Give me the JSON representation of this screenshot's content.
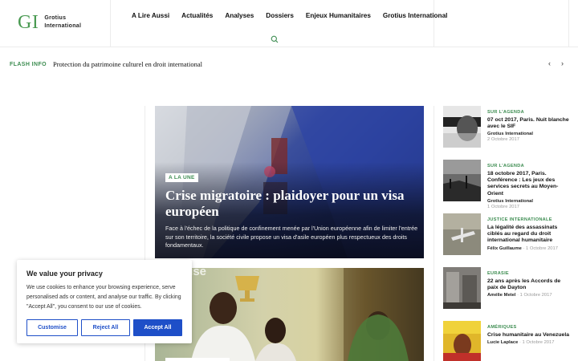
{
  "header": {
    "logo_mark": "GI",
    "logo_line1": "Grotius",
    "logo_line2": "International",
    "nav": [
      "A Lire Aussi",
      "Actualités",
      "Analyses",
      "Dossiers",
      "Enjeux Humanitaires",
      "Grotius International"
    ]
  },
  "flash": {
    "label": "FLASH INFO",
    "text": "Protection du patrimoine culturel en droit international",
    "prev": "‹",
    "next": "›"
  },
  "hero": {
    "tag": "A LA UNE",
    "title": "Crise migratoire : plaidoyer pour un visa européen",
    "description": "Face à l'échec de la politique de confinement menée par l'Union européenne afin de limiter l'entrée sur son territoire, la société civile propose un visa d'asile européen plus respectueux des droits fondamentaux.",
    "second_image_text": "ertise"
  },
  "cookie": {
    "title": "We value your privacy",
    "text": "We use cookies to enhance your browsing experience, serve personalised ads or content, and analyse our traffic. By clicking \"Accept All\", you consent to our use of cookies.",
    "customise": "Customise",
    "reject": "Reject All",
    "accept": "Accept All"
  },
  "sidebar": [
    {
      "category": "SUR L'AGENDA",
      "title": "07 oct 2017, Paris. Nuit blanche avec le SIF",
      "author": "Grotius International",
      "date": "2 Octobre 2017"
    },
    {
      "category": "SUR L'AGENDA",
      "title": "18 octobre 2017, Paris. Conférence : Les jeux des services secrets au Moyen-Orient",
      "author": "Grotius International",
      "date": "1 Octobre 2017"
    },
    {
      "category": "JUSTICE INTERNATIONALE",
      "title": "La légalité des assassinats ciblés au regard du droit international humanitaire",
      "author": "Félix Guillaume",
      "date": "1 Octobre 2017"
    },
    {
      "category": "EURASIE",
      "title": "22 ans après les Accords de paix de Dayton",
      "author": "Amélie Metel",
      "date": "1 Octobre 2017"
    },
    {
      "category": "AMÉRIQUES",
      "title": "Crise humanitaire au Venezuela",
      "author": "Lucie Laplace",
      "date": "1 Octobre 2017"
    }
  ],
  "colors": {
    "accent_green": "#3c8c50",
    "button_blue": "#1e4fc8"
  }
}
